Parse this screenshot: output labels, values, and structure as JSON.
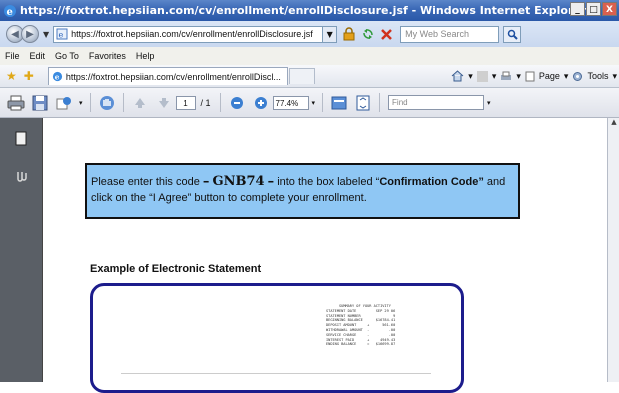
{
  "window": {
    "title": "https://foxtrot.hepsiian.com/cv/enrollment/enrollDisclosure.jsf - Windows Internet Explorer",
    "controls": [
      "_",
      "□",
      "X"
    ]
  },
  "address_bar": {
    "url": "https://foxtrot.hepsiian.com/cv/enrollment/enrollDisclosure.jsf",
    "search_placeholder": "My Web Search"
  },
  "menu": {
    "items": [
      "File",
      "Edit",
      "Go To",
      "Favorites",
      "Help"
    ]
  },
  "tabs": {
    "active_title": "https://foxtrot.hepsiian.com/cv/enrollment/enrollDiscl...",
    "page_label": "Page",
    "tools_label": "Tools"
  },
  "pdf_toolbar": {
    "page_current": "1",
    "page_total": "/ 1",
    "zoom": "77.4%",
    "find_placeholder": "Find"
  },
  "document": {
    "instruction_pre": "Please enter this code",
    "code_dash_left": "–",
    "code": "GNB74",
    "code_dash_right": "–",
    "instruction_mid": "into the box labeled “",
    "field_name": "Confirmation Code”",
    "instruction_post": "and click on the “I Agree” button to complete your enrollment.",
    "example_heading": "Example of Electronic Statement",
    "statement": {
      "heading": "SUMMARY OF YOUR ACTIVITY",
      "rows": [
        [
          "STATEMENT DATE",
          "SEP 29 06"
        ],
        [
          "STATEMENT NUMBER",
          "9"
        ],
        [
          "BEGINNING BALANCE",
          "$16784.41"
        ],
        [
          "DEPOSIT AMOUNT",
          "+",
          "561.60"
        ],
        [
          "WITHDRAWAL AMOUNT",
          "-",
          ".00"
        ],
        [
          "SERVICE CHARGE",
          "-",
          ".00"
        ],
        [
          "INTEREST PAID",
          "+",
          "4949.43"
        ],
        [
          "ENDING BALANCE",
          "=",
          "$16699.87"
        ]
      ]
    }
  },
  "colors": {
    "titlebar": "#3a68b6",
    "code_box": "#8fc7f4",
    "statement_border": "#1c1c8c",
    "nav_pane": "#5a5f66"
  }
}
